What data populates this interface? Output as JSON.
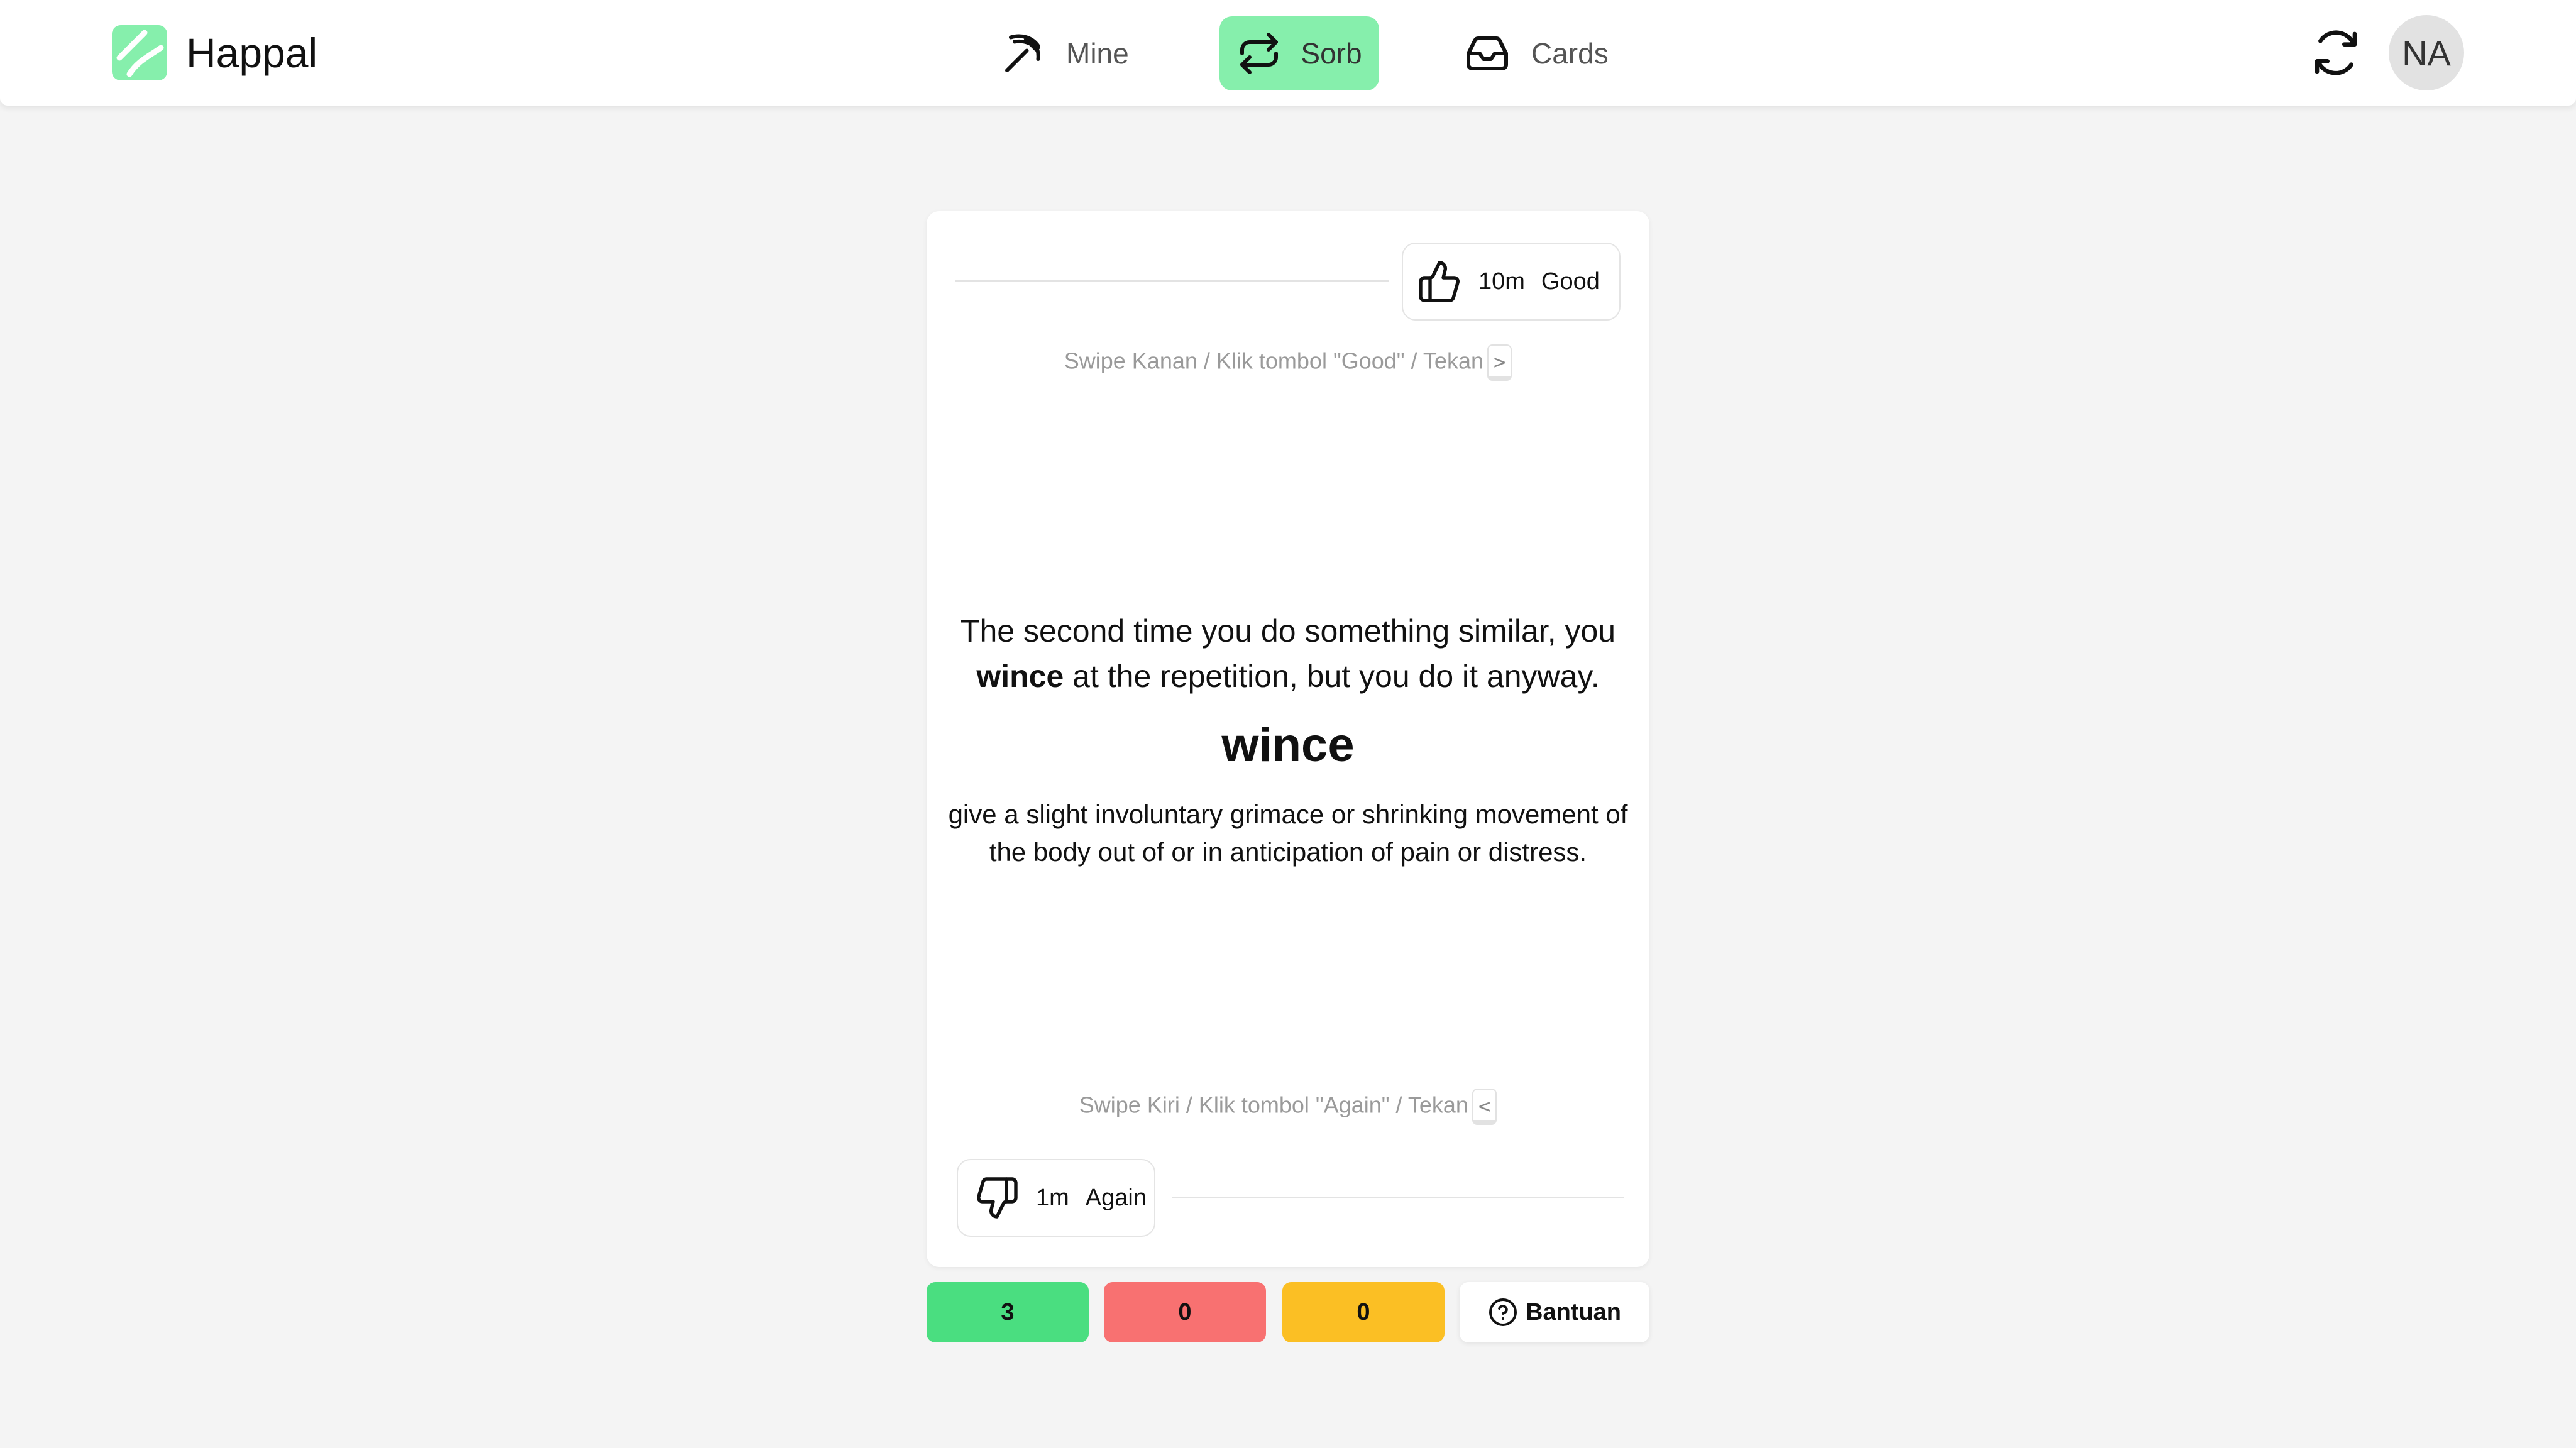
{
  "header": {
    "app_name": "Happal",
    "accent_color": "#86efac",
    "nav": [
      {
        "label": "Mine",
        "icon": "pickaxe-icon",
        "active": false
      },
      {
        "label": "Sorb",
        "icon": "repeat-icon",
        "active": true
      },
      {
        "label": "Cards",
        "icon": "inbox-icon",
        "active": false
      }
    ],
    "refresh_icon": "refresh-icon",
    "avatar_initials": "NA"
  },
  "card": {
    "good": {
      "time": "10m",
      "label": "Good",
      "icon": "thumbs-up-icon"
    },
    "again": {
      "time": "1m",
      "label": "Again",
      "icon": "thumbs-down-icon"
    },
    "hint_top": {
      "text": "Swipe Kanan / Klik tombol \"Good\" / Tekan",
      "key": ">"
    },
    "hint_bottom": {
      "text": "Swipe Kiri / Klik tombol \"Again\" / Tekan",
      "key": "<"
    },
    "sentence": {
      "before": "The second time you do something similar, you ",
      "highlight": "wince",
      "after": " at the repetition, but you do it anyway."
    },
    "word": "wince",
    "definition": "give a slight involuntary grimace or shrinking movement of the body out of or in anticipation of pain or distress."
  },
  "stats": {
    "green": {
      "value": "3",
      "color": "#4ade80"
    },
    "red": {
      "value": "0",
      "color": "#f87171"
    },
    "yellow": {
      "value": "0",
      "color": "#fbbf24"
    },
    "help_label": "Bantuan",
    "help_icon": "help-circle-icon"
  }
}
